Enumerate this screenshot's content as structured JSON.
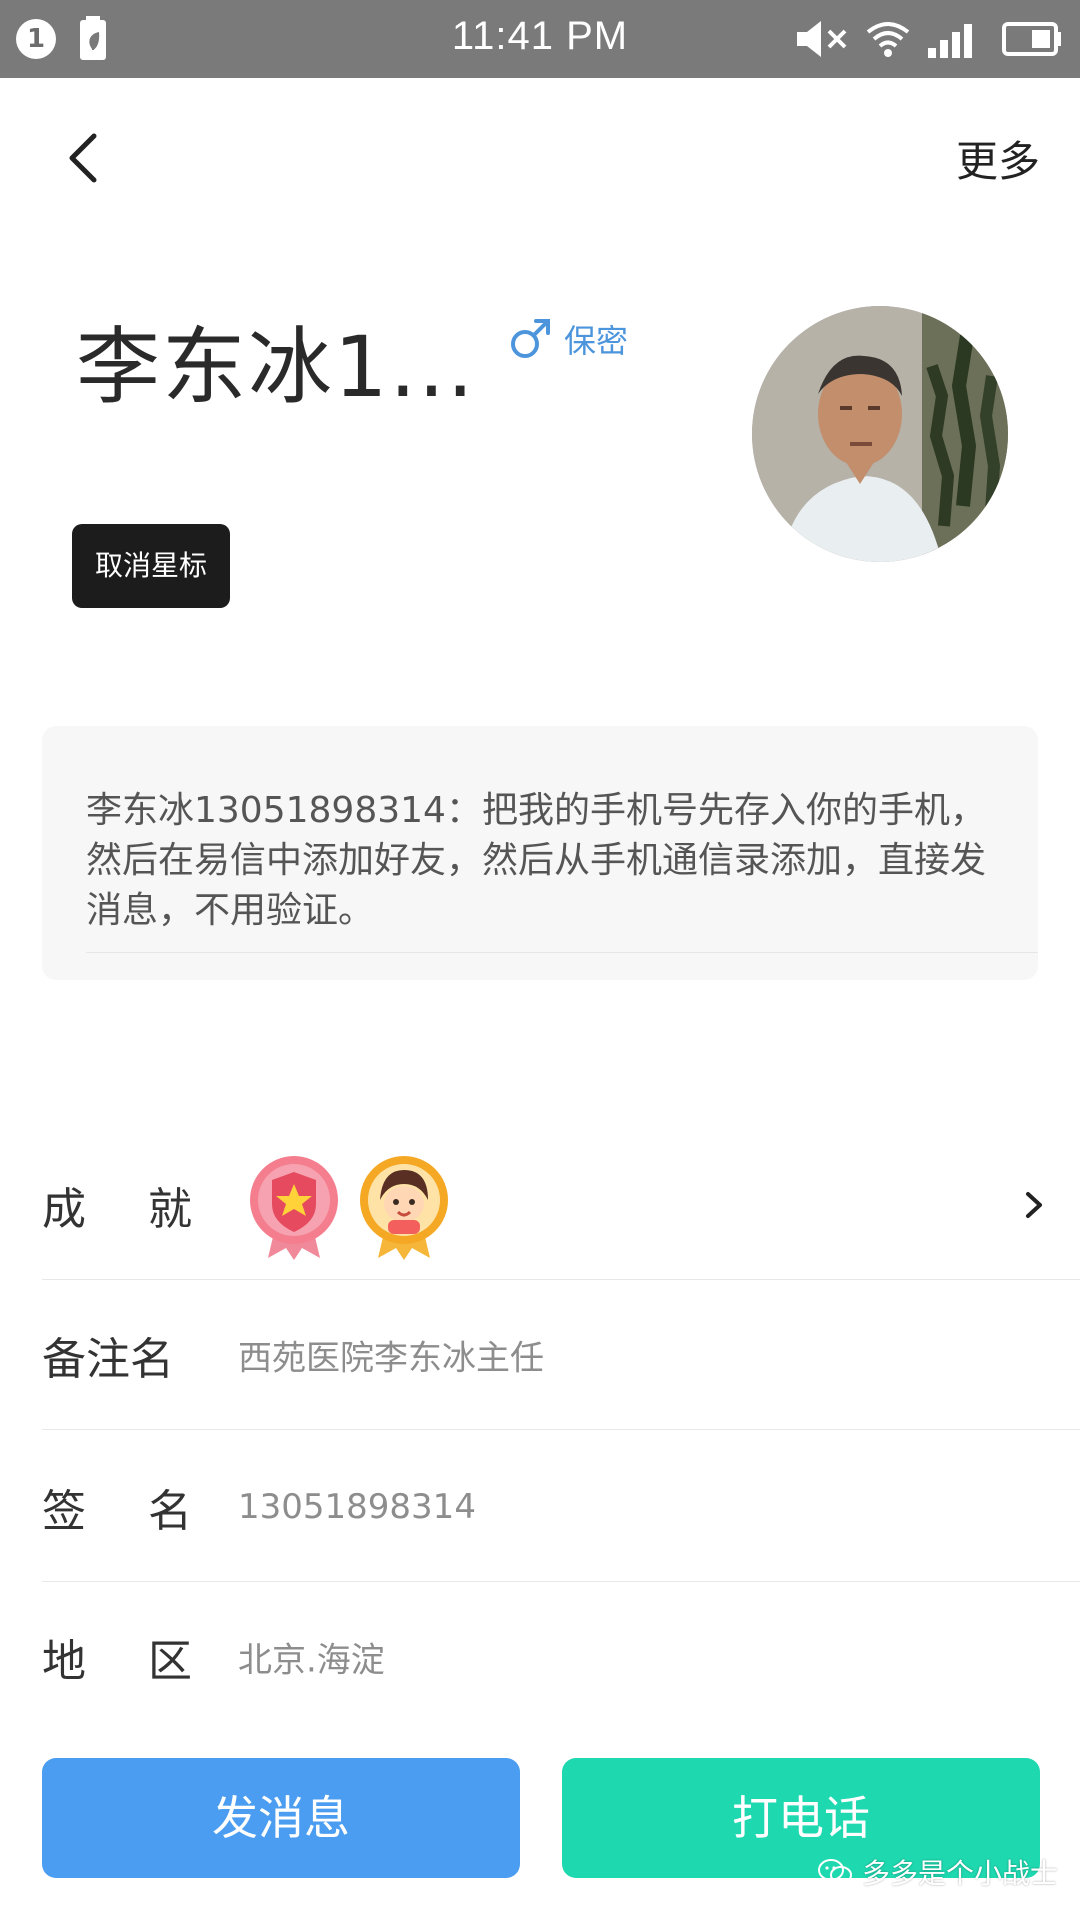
{
  "status_bar": {
    "notification_count": "1",
    "time": "11:41 PM",
    "icons": [
      "battery-saver-icon",
      "mute-icon",
      "wifi-icon",
      "signal-icon",
      "battery-icon"
    ]
  },
  "header": {
    "back_icon": "chevron-left-icon",
    "more_label": "更多"
  },
  "profile": {
    "name": "李东冰1...",
    "gender_icon": "male-icon",
    "gender_label": "保密",
    "star_button_label": "取消星标",
    "avatar_icon": "avatar-photo"
  },
  "message": {
    "text": "李东冰13051898314：把我的手机号先存入你的手机，然后在易信中添加好友，然后从手机通信录添加，直接发消息，不用验证。"
  },
  "info": {
    "achievements_label": [
      "成",
      "就"
    ],
    "remark_label": "备注名",
    "remark_value": "西苑医院李东冰主任",
    "signature_label": [
      "签",
      "名"
    ],
    "signature_value": "13051898314",
    "region_label": [
      "地",
      "区"
    ],
    "region_value": "北京.海淀"
  },
  "actions": {
    "send_message": "发消息",
    "call": "打电话"
  },
  "watermark": {
    "text": "多多是个小战士"
  },
  "colors": {
    "status_bar": "#7a7a7a",
    "message_button": "#4a9df0",
    "call_button": "#1ed8b0",
    "gender_blue": "#4c95dc",
    "star_button": "#1c1c1c"
  }
}
